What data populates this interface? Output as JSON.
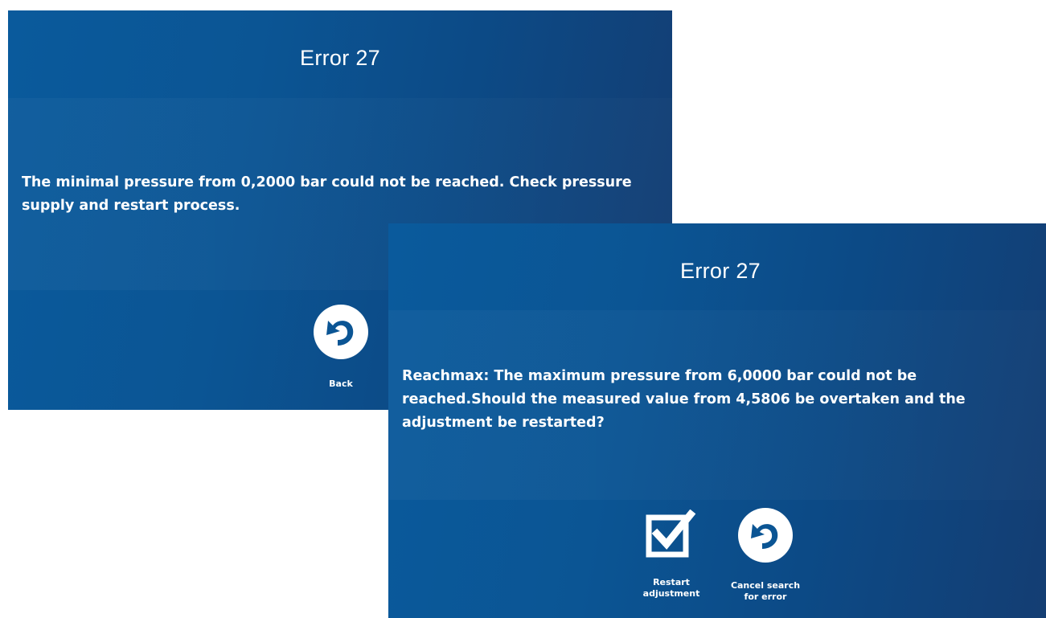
{
  "screens": [
    {
      "title": "Error 27",
      "message": "The minimal pressure from 0,2000 bar could not be reached. Check pressure supply and restart process.",
      "actions": [
        {
          "label": "Back",
          "icon": "undo-arrow-icon"
        }
      ]
    },
    {
      "title": "Error 27",
      "message": "Reachmax: The maximum  pressure from 6,0000 bar could not be reached.Should the measured value from 4,5806 be overtaken and the adjustment be restarted?",
      "actions": [
        {
          "label": "Restart\nadjustment",
          "icon": "checkbox-checked-icon"
        },
        {
          "label": "Cancel search\nfor error",
          "icon": "undo-arrow-icon"
        }
      ]
    }
  ],
  "colors": {
    "panel_background": "#0b5594",
    "text": "#ffffff"
  }
}
